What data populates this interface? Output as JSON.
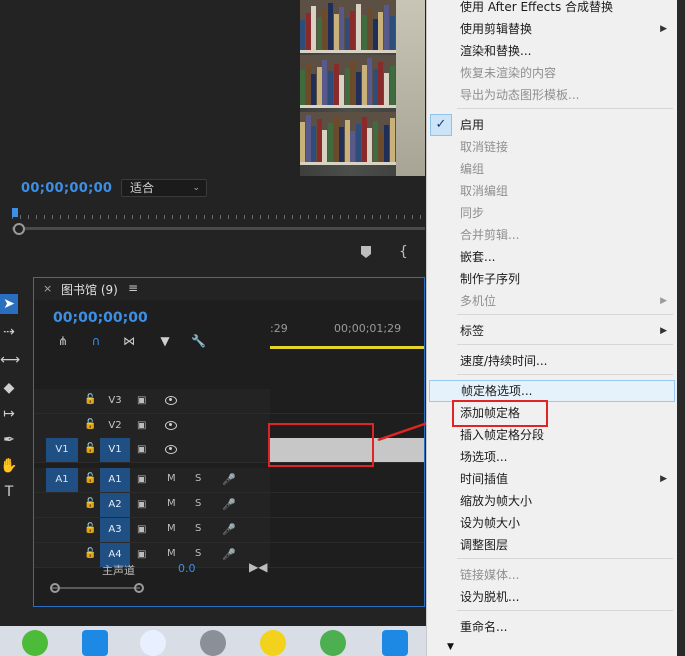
{
  "monitor": {
    "timecode": "00;00;00;00",
    "fit_value": "适合"
  },
  "timeline": {
    "panel_title": "图书馆 (9)",
    "timecode": "00;00;00;00",
    "ruler_labels": [
      ":29",
      "00;00;01;29"
    ],
    "tracks": [
      {
        "source": "",
        "target": "V3",
        "kind": "video"
      },
      {
        "source": "",
        "target": "V2",
        "kind": "video"
      },
      {
        "source": "V1",
        "target": "V1",
        "kind": "video"
      },
      {
        "source": "A1",
        "target": "A1",
        "kind": "audio"
      },
      {
        "source": "",
        "target": "A2",
        "kind": "audio"
      },
      {
        "source": "",
        "target": "A3",
        "kind": "audio"
      },
      {
        "source": "",
        "target": "A4",
        "kind": "audio"
      }
    ],
    "mute_label": "M",
    "solo_label": "S",
    "master_label": "主声道",
    "master_value": "0.0"
  },
  "context_menu": {
    "items": [
      {
        "label": "使用 After Effects 合成替换",
        "disabled": false,
        "submenu": false
      },
      {
        "label": "使用剪辑替换",
        "disabled": false,
        "submenu": true
      },
      {
        "label": "渲染和替换...",
        "disabled": false,
        "submenu": false
      },
      {
        "label": "恢复未渲染的内容",
        "disabled": true,
        "submenu": false
      },
      {
        "label": "导出为动态图形模板...",
        "disabled": true,
        "submenu": false
      },
      {
        "label": "启用",
        "disabled": false,
        "submenu": false,
        "checked": true
      },
      {
        "label": "取消链接",
        "disabled": true,
        "submenu": false
      },
      {
        "label": "编组",
        "disabled": true,
        "submenu": false
      },
      {
        "label": "取消编组",
        "disabled": true,
        "submenu": false
      },
      {
        "label": "同步",
        "disabled": true,
        "submenu": false
      },
      {
        "label": "合并剪辑...",
        "disabled": true,
        "submenu": false
      },
      {
        "label": "嵌套...",
        "disabled": false,
        "submenu": false
      },
      {
        "label": "制作子序列",
        "disabled": false,
        "submenu": false
      },
      {
        "label": "多机位",
        "disabled": true,
        "submenu": true
      },
      {
        "label": "标签",
        "disabled": false,
        "submenu": true
      },
      {
        "label": "速度/持续时间...",
        "disabled": false,
        "submenu": false
      },
      {
        "label": "帧定格选项...",
        "disabled": false,
        "submenu": false,
        "hover": true
      },
      {
        "label": "添加帧定格",
        "disabled": false,
        "submenu": false
      },
      {
        "label": "插入帧定格分段",
        "disabled": false,
        "submenu": false
      },
      {
        "label": "场选项...",
        "disabled": false,
        "submenu": false
      },
      {
        "label": "时间插值",
        "disabled": false,
        "submenu": true
      },
      {
        "label": "缩放为帧大小",
        "disabled": false,
        "submenu": false
      },
      {
        "label": "设为帧大小",
        "disabled": false,
        "submenu": false
      },
      {
        "label": "调整图层",
        "disabled": false,
        "submenu": false
      },
      {
        "label": "链接媒体...",
        "disabled": true,
        "submenu": false
      },
      {
        "label": "设为脱机...",
        "disabled": false,
        "submenu": false
      },
      {
        "label": "重命名...",
        "disabled": false,
        "submenu": false
      }
    ],
    "check_mark": "✓"
  },
  "taskbar": {
    "icons": [
      "android-icon",
      "p-app-icon",
      "cloud-app-icon",
      "camera-app-icon",
      "yellow-app-icon",
      "green-app-icon",
      "blue-star-app-icon"
    ]
  },
  "colors": {
    "accent": "#3d8fe6",
    "annotation": "#e02323",
    "menu_bg": "#f0f0f0",
    "work_area": "#e6d42a"
  }
}
